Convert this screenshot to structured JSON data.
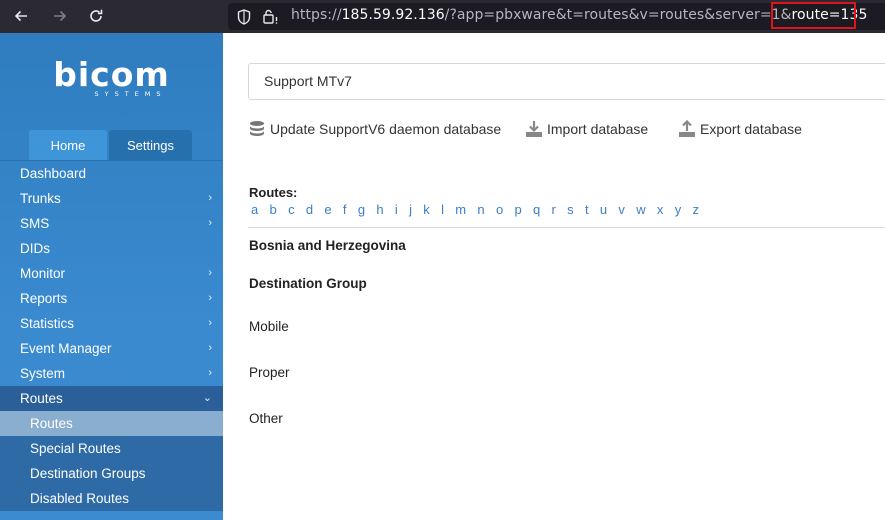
{
  "browser": {
    "url_prefix": "https://",
    "url_host": "185.59.92.136",
    "url_path": "/?app=pbxware&t=routes&v=routes&server=1&",
    "url_highlight": "route=135",
    "highlight_color": "#e0141e"
  },
  "logo": {
    "word": "bicom",
    "sub": "SYSTEMS"
  },
  "tabs": {
    "home": "Home",
    "settings": "Settings"
  },
  "menu": {
    "items": [
      {
        "label": "Dashboard",
        "chevron": ""
      },
      {
        "label": "Trunks",
        "chevron": "›"
      },
      {
        "label": "SMS",
        "chevron": "›"
      },
      {
        "label": "DIDs",
        "chevron": ""
      },
      {
        "label": "Monitor",
        "chevron": "›"
      },
      {
        "label": "Reports",
        "chevron": "›"
      },
      {
        "label": "Statistics",
        "chevron": "›"
      },
      {
        "label": "Event Manager",
        "chevron": "›"
      },
      {
        "label": "System",
        "chevron": "›"
      },
      {
        "label": "Routes",
        "chevron": "⌄"
      }
    ],
    "sub_items": [
      "Routes",
      "Special Routes",
      "Destination Groups",
      "Disabled Routes"
    ]
  },
  "main": {
    "server_select": "Support MTv7",
    "actions": {
      "update": "Update SupportV6 daemon database",
      "import": "Import database",
      "export": "Export database"
    },
    "routes_label": "Routes:",
    "letters": [
      "a",
      "b",
      "c",
      "d",
      "e",
      "f",
      "g",
      "h",
      "i",
      "j",
      "k",
      "l",
      "m",
      "n",
      "o",
      "p",
      "q",
      "r",
      "s",
      "t",
      "u",
      "v",
      "w",
      "x",
      "y",
      "z"
    ],
    "country": "Bosnia and Herzegovina",
    "destination_group": "Destination Group",
    "route_rows": [
      "Mobile",
      "Proper",
      "Other"
    ]
  }
}
